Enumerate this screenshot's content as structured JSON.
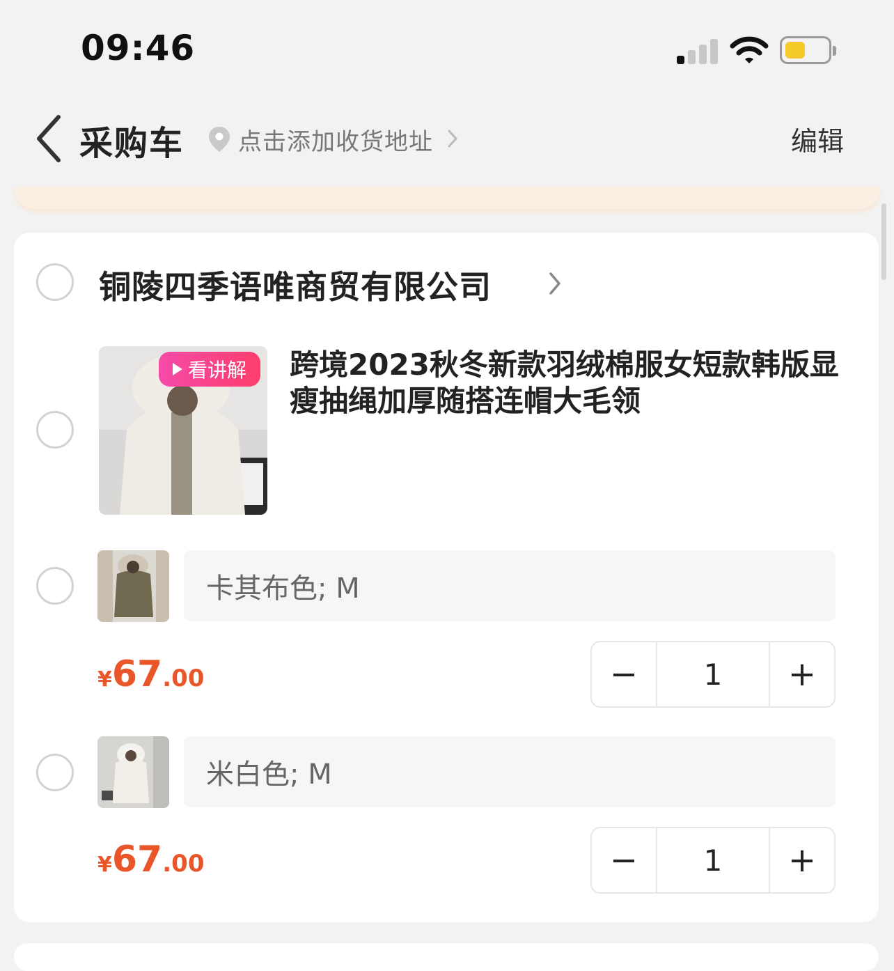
{
  "status_bar": {
    "time": "09:46",
    "battery_level": 0.45
  },
  "header": {
    "title": "采购车",
    "address_prompt": "点击添加收货地址",
    "edit_label": "编辑"
  },
  "store": {
    "name": "铜陵四季语唯商贸有限公司"
  },
  "product": {
    "title": "跨境2023秋冬新款羽绒棉服女短款韩版显瘦抽绳加厚随搭连帽大毛领",
    "live_badge": "看讲解"
  },
  "skus": [
    {
      "variant": "卡其布色; M",
      "currency": "¥",
      "price_int": "67",
      "price_dec": ".00",
      "quantity": "1"
    },
    {
      "variant": "米白色; M",
      "currency": "¥",
      "price_int": "67",
      "price_dec": ".00",
      "quantity": "1"
    }
  ],
  "stepper": {
    "minus": "−",
    "plus": "+"
  }
}
